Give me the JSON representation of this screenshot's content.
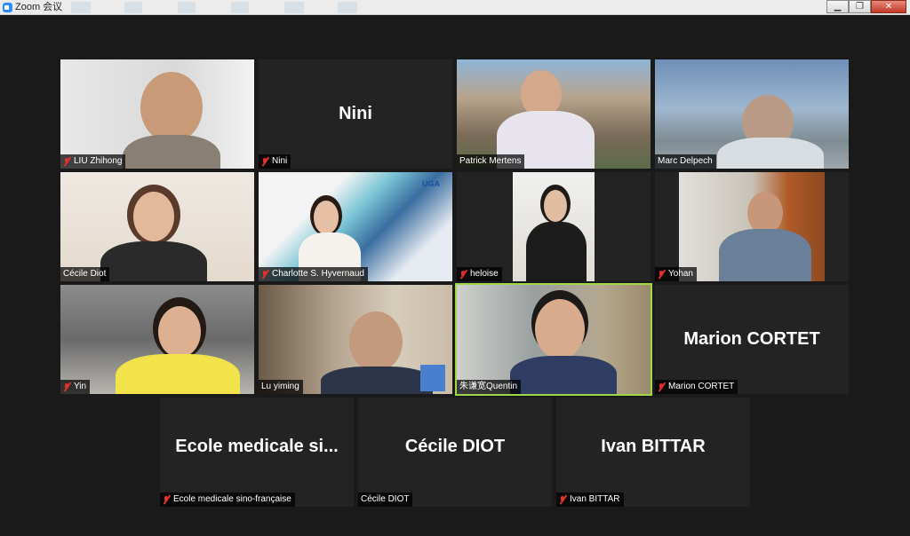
{
  "window": {
    "title": "Zoom 会议",
    "minimize": "▁",
    "restore": "❐",
    "close": "✕"
  },
  "participants": [
    {
      "name": "LIU Zhihong",
      "muted": true
    },
    {
      "name": "Nini",
      "muted": true,
      "video_off": true
    },
    {
      "name": "Patrick Mertens",
      "muted": false
    },
    {
      "name": "Marc Delpech",
      "muted": false
    },
    {
      "name": "Cécile Diot",
      "muted": false
    },
    {
      "name": "Charlotte S. Hyvernaud",
      "muted": true
    },
    {
      "name": "heloise",
      "muted": true
    },
    {
      "name": "Yohan",
      "muted": true
    },
    {
      "name": "Yin",
      "muted": true
    },
    {
      "name": "Lu yiming",
      "muted": false
    },
    {
      "name": "朱谦宽Quentin",
      "muted": false,
      "active_speaker": true
    },
    {
      "name": "Marion CORTET",
      "muted": true,
      "video_off": true,
      "big": "Marion CORTET"
    },
    {
      "name": "Ecole medicale sino-française",
      "muted": true,
      "video_off": true,
      "big": "Ecole medicale si..."
    },
    {
      "name": "Cécile DIOT",
      "muted": false,
      "video_off": true,
      "big": "Cécile DIOT"
    },
    {
      "name": "Ivan BITTAR",
      "muted": true,
      "video_off": true,
      "big": "Ivan BITTAR"
    }
  ],
  "uga_logo": "UGA",
  "colors": {
    "active_border": "#9ed64a",
    "mute": "#e0302a",
    "background": "#1a1a1a"
  }
}
